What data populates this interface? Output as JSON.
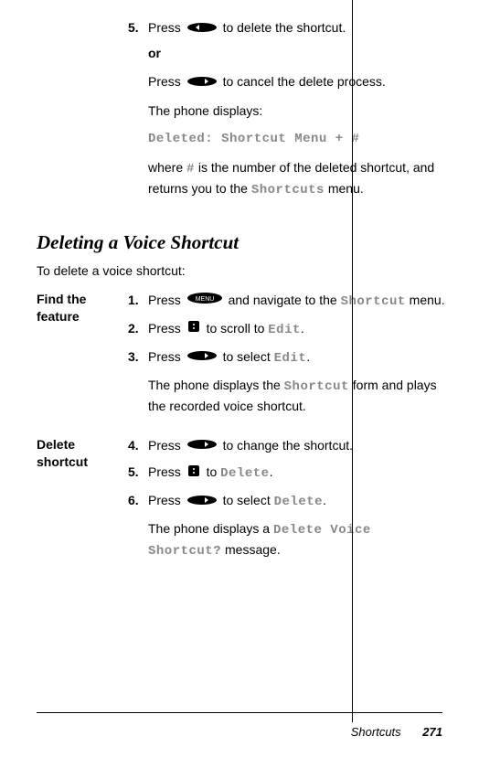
{
  "top": {
    "step5": {
      "num": "5.",
      "text_a": "Press ",
      "text_b": " to delete the shortcut."
    },
    "or": "or",
    "cancel": {
      "text_a": "Press ",
      "text_b": " to cancel the delete process."
    },
    "displays": "The phone displays:",
    "deleted_line": "Deleted: Shortcut Menu + #",
    "where_a": "where ",
    "where_hash": "#",
    "where_b": " is the number of the deleted shortcut, and returns you to the ",
    "where_menu": "Shortcuts",
    "where_c": " menu."
  },
  "section_title": "Deleting a Voice Shortcut",
  "intro": "To delete a voice shortcut:",
  "find": {
    "label": "Find the feature",
    "s1": {
      "num": "1.",
      "a": "Press ",
      "b": " and navigate to the ",
      "menu": "Shortcut",
      "c": " menu."
    },
    "s2": {
      "num": "2.",
      "a": "Press ",
      "b": " to scroll to ",
      "edit": "Edit",
      "c": "."
    },
    "s3": {
      "num": "3.",
      "a": "Press ",
      "b": " to select ",
      "edit": "Edit",
      "c": "."
    },
    "s3_sub": {
      "a": "The phone displays the ",
      "menu": "Shortcut",
      "b": " form and plays the recorded voice shortcut."
    }
  },
  "del": {
    "label": "Delete shortcut",
    "s4": {
      "num": "4.",
      "a": "Press ",
      "b": " to change the shortcut."
    },
    "s5": {
      "num": "5.",
      "a": "Press ",
      "b": " to ",
      "del": "Delete",
      "c": "."
    },
    "s6": {
      "num": "6.",
      "a": "Press ",
      "b": " to select ",
      "del": "Delete",
      "c": "."
    },
    "s6_sub": {
      "a": "The phone displays a ",
      "msg": "Delete Voice Shortcut?",
      "b": " message."
    }
  },
  "footer": {
    "label": "Shortcuts",
    "page": "271"
  }
}
